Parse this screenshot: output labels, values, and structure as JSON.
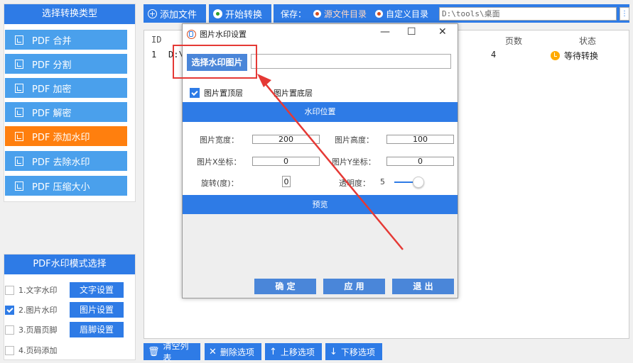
{
  "left": {
    "header": "选择转换类型",
    "items": [
      {
        "label": "PDF 合并"
      },
      {
        "label": "PDF 分割"
      },
      {
        "label": "PDF 加密"
      },
      {
        "label": "PDF 解密"
      },
      {
        "label": "PDF 添加水印"
      },
      {
        "label": "PDF 去除水印"
      },
      {
        "label": "PDF 压缩大小"
      }
    ],
    "active_index": 4
  },
  "mode": {
    "header": "PDF水印模式选择",
    "rows": [
      {
        "label": "1.文字水印",
        "checked": false,
        "button": "文字设置"
      },
      {
        "label": "2.图片水印",
        "checked": true,
        "button": "图片设置"
      },
      {
        "label": "3.页眉页脚",
        "checked": false,
        "button": "眉脚设置"
      },
      {
        "label": "4.页码添加",
        "checked": false,
        "button": ""
      }
    ]
  },
  "toolbar": {
    "add_file": "添加文件",
    "start": "开始转换",
    "save_label": "保存：",
    "source_dir": "源文件目录",
    "custom_dir": "自定义目录",
    "path": "D:\\tools\\桌面",
    "more": "⋮"
  },
  "table": {
    "headers": {
      "id": "ID",
      "pages": "页数",
      "status": "状态"
    },
    "rows": [
      {
        "id": "1",
        "path": "D:\\",
        "pages": "4",
        "status": "等待转换"
      }
    ]
  },
  "bottom": {
    "clear": "清空列表",
    "delete": "删除选项",
    "up": "上移选项",
    "down": "下移选项"
  },
  "dialog": {
    "title": "图片水印设置",
    "minimize": "—",
    "maximize": "☐",
    "close": "✕",
    "select_btn": "选择水印图片",
    "select_value": "",
    "top_layer": "图片置顶层",
    "bottom_layer": "图片置底层",
    "top_checked": true,
    "bottom_checked": false,
    "position_bar": "水印位置",
    "width_label": "图片宽度：",
    "width_value": "200",
    "height_label": "图片高度：",
    "height_value": "100",
    "x_label": "图片X坐标：",
    "x_value": "0",
    "y_label": "图片Y坐标：",
    "y_value": "0",
    "rotate_label": "旋转(度)：",
    "rotate_value": "0",
    "opacity_label": "透明度：",
    "opacity_value": "5",
    "preview": "预览",
    "ok": "确 定",
    "apply": "应 用",
    "exit": "退 出"
  },
  "colors": {
    "primary": "#2e7be6",
    "active": "#ff7f0e",
    "annotation": "#e53935"
  }
}
